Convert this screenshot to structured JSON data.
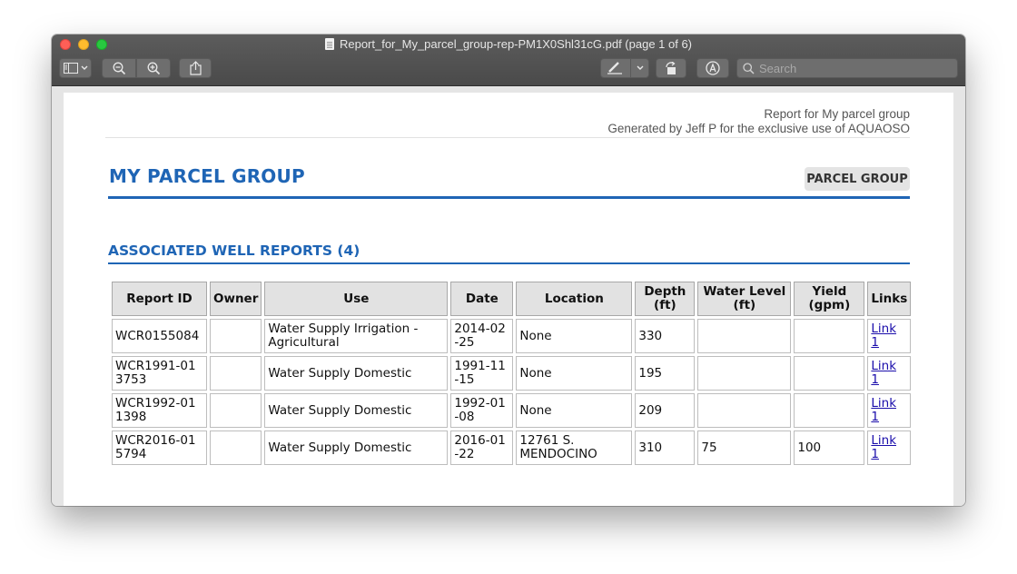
{
  "window": {
    "title": "Report_for_My_parcel_group-rep-PM1X0Shl31cG.pdf (page 1 of 6)"
  },
  "toolbar": {
    "search_placeholder": "Search",
    "icons": [
      "sidebar-icon",
      "chevron-down-icon",
      "zoom-out-icon",
      "zoom-in-icon",
      "share-icon",
      "markup-pen-icon",
      "rotate-icon",
      "annotate-icon",
      "search-icon"
    ]
  },
  "report": {
    "header_line1": "Report for My parcel group",
    "header_line2": "Generated by Jeff P for the exclusive use of AQUAOSO",
    "title": "MY PARCEL GROUP",
    "badge": "PARCEL GROUP",
    "section_title": "ASSOCIATED WELL REPORTS (4)",
    "accent_color": "#1f65b5"
  },
  "table": {
    "headers": [
      "Report ID",
      "Owner",
      "Use",
      "Date",
      "Location",
      "Depth (ft)",
      "Water Level (ft)",
      "Yield (gpm)",
      "Links"
    ],
    "rows": [
      {
        "report_id": "WCR0155084",
        "owner": "",
        "use": "Water Supply Irrigation - Agricultural",
        "date": "2014-02-25",
        "location": "None",
        "depth": "330",
        "water_level": "",
        "yield": "",
        "link": "Link 1"
      },
      {
        "report_id": "WCR1991-013753",
        "owner": "",
        "use": "Water Supply Domestic",
        "date": "1991-11-15",
        "location": "None",
        "depth": "195",
        "water_level": "",
        "yield": "",
        "link": "Link 1"
      },
      {
        "report_id": "WCR1992-011398",
        "owner": "",
        "use": "Water Supply Domestic",
        "date": "1992-01-08",
        "location": "None",
        "depth": "209",
        "water_level": "",
        "yield": "",
        "link": "Link 1"
      },
      {
        "report_id": "WCR2016-015794",
        "owner": "",
        "use": "Water Supply Domestic",
        "date": "2016-01-22",
        "location": "12761 S. MENDOCINO",
        "depth": "310",
        "water_level": "75",
        "yield": "100",
        "link": "Link 1"
      }
    ]
  }
}
